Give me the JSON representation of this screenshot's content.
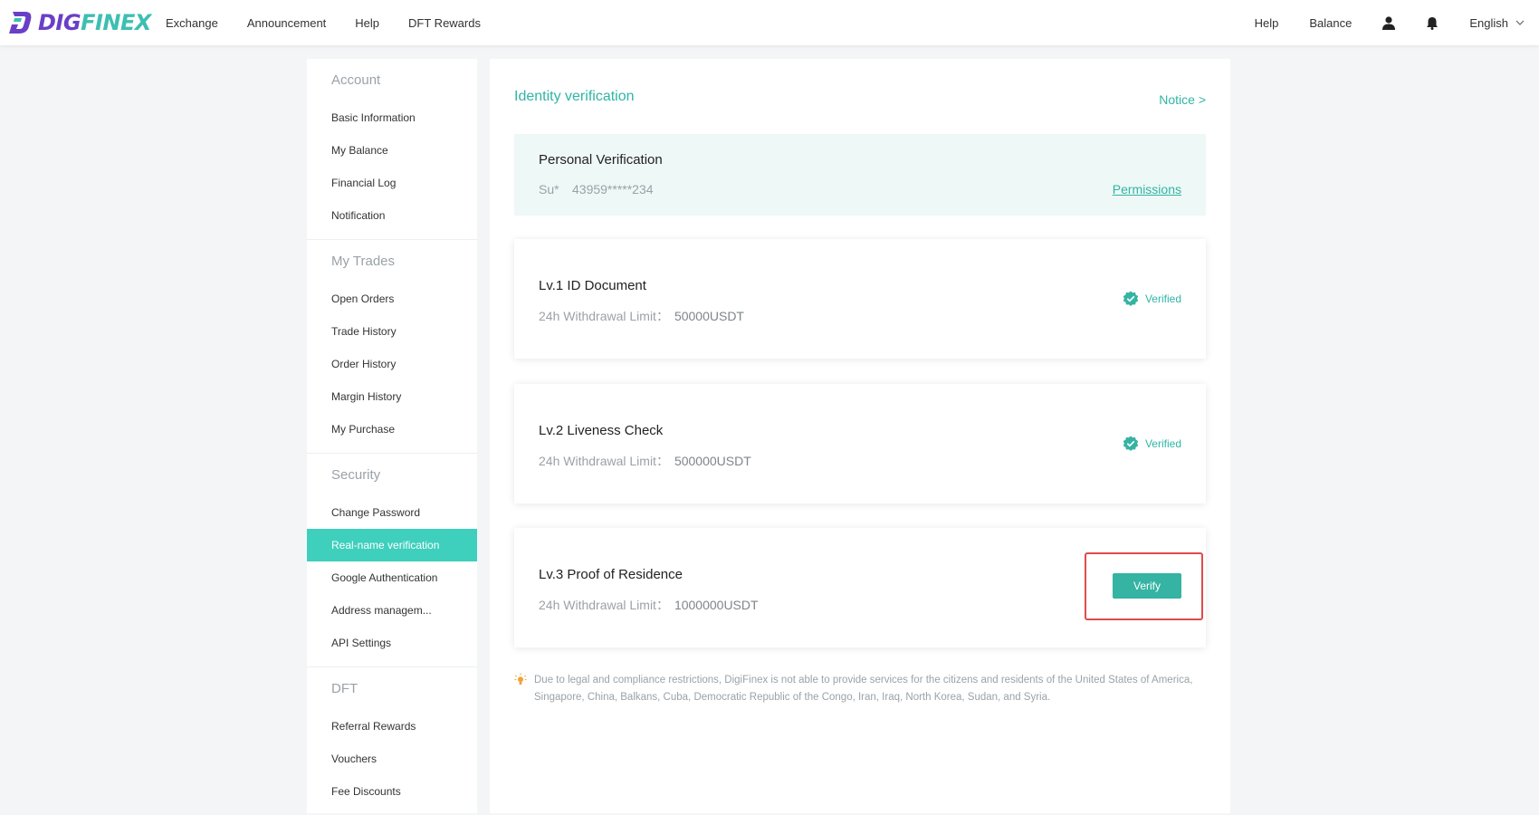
{
  "brand": {
    "part1": "DIG",
    "part2": "FINEX",
    "purple": "#6a3fc7",
    "teal": "#3dbfb2"
  },
  "nav": {
    "left": [
      "Exchange",
      "Announcement",
      "Help",
      "DFT Rewards"
    ],
    "right_help": "Help",
    "right_balance": "Balance",
    "language": "English"
  },
  "sidebar": {
    "groups": [
      {
        "title": "Account",
        "items": [
          "Basic Information",
          "My Balance",
          "Financial Log",
          "Notification"
        ]
      },
      {
        "title": "My Trades",
        "items": [
          "Open Orders",
          "Trade History",
          "Order History",
          "Margin History",
          "My Purchase"
        ]
      },
      {
        "title": "Security",
        "items": [
          "Change Password",
          "Real-name verification",
          "Google Authentication",
          "Address managem...",
          "API Settings"
        ]
      },
      {
        "title": "DFT",
        "items": [
          "Referral Rewards",
          "Vouchers",
          "Fee Discounts"
        ]
      }
    ],
    "active_item": "Real-name verification"
  },
  "main": {
    "title": "Identity verification",
    "notice": "Notice >",
    "personal": {
      "title": "Personal Verification",
      "name": "Su*",
      "id": "43959*****234",
      "permissions": "Permissions"
    },
    "levels": [
      {
        "title": "Lv.1 ID Document",
        "limit_label": "24h Withdrawal Limit：",
        "limit_value": "50000USDT",
        "status": "Verified"
      },
      {
        "title": "Lv.2 Liveness Check",
        "limit_label": "24h Withdrawal Limit：",
        "limit_value": "500000USDT",
        "status": "Verified"
      },
      {
        "title": "Lv.3 Proof of Residence",
        "limit_label": "24h Withdrawal Limit：",
        "limit_value": "1000000USDT",
        "action": "Verify"
      }
    ],
    "disclaimer": "Due to legal and compliance restrictions, DigiFinex is not able to provide services for the citizens and residents of the United States of America, Singapore, China, Balkans, Cuba, Democratic Republic of the Congo, Iran, Iraq, North Korea, Sudan, and Syria."
  },
  "colors": {
    "accent": "#3ecfbd",
    "teal_text": "#2fb5a5",
    "highlight_border": "#e04b4b"
  }
}
